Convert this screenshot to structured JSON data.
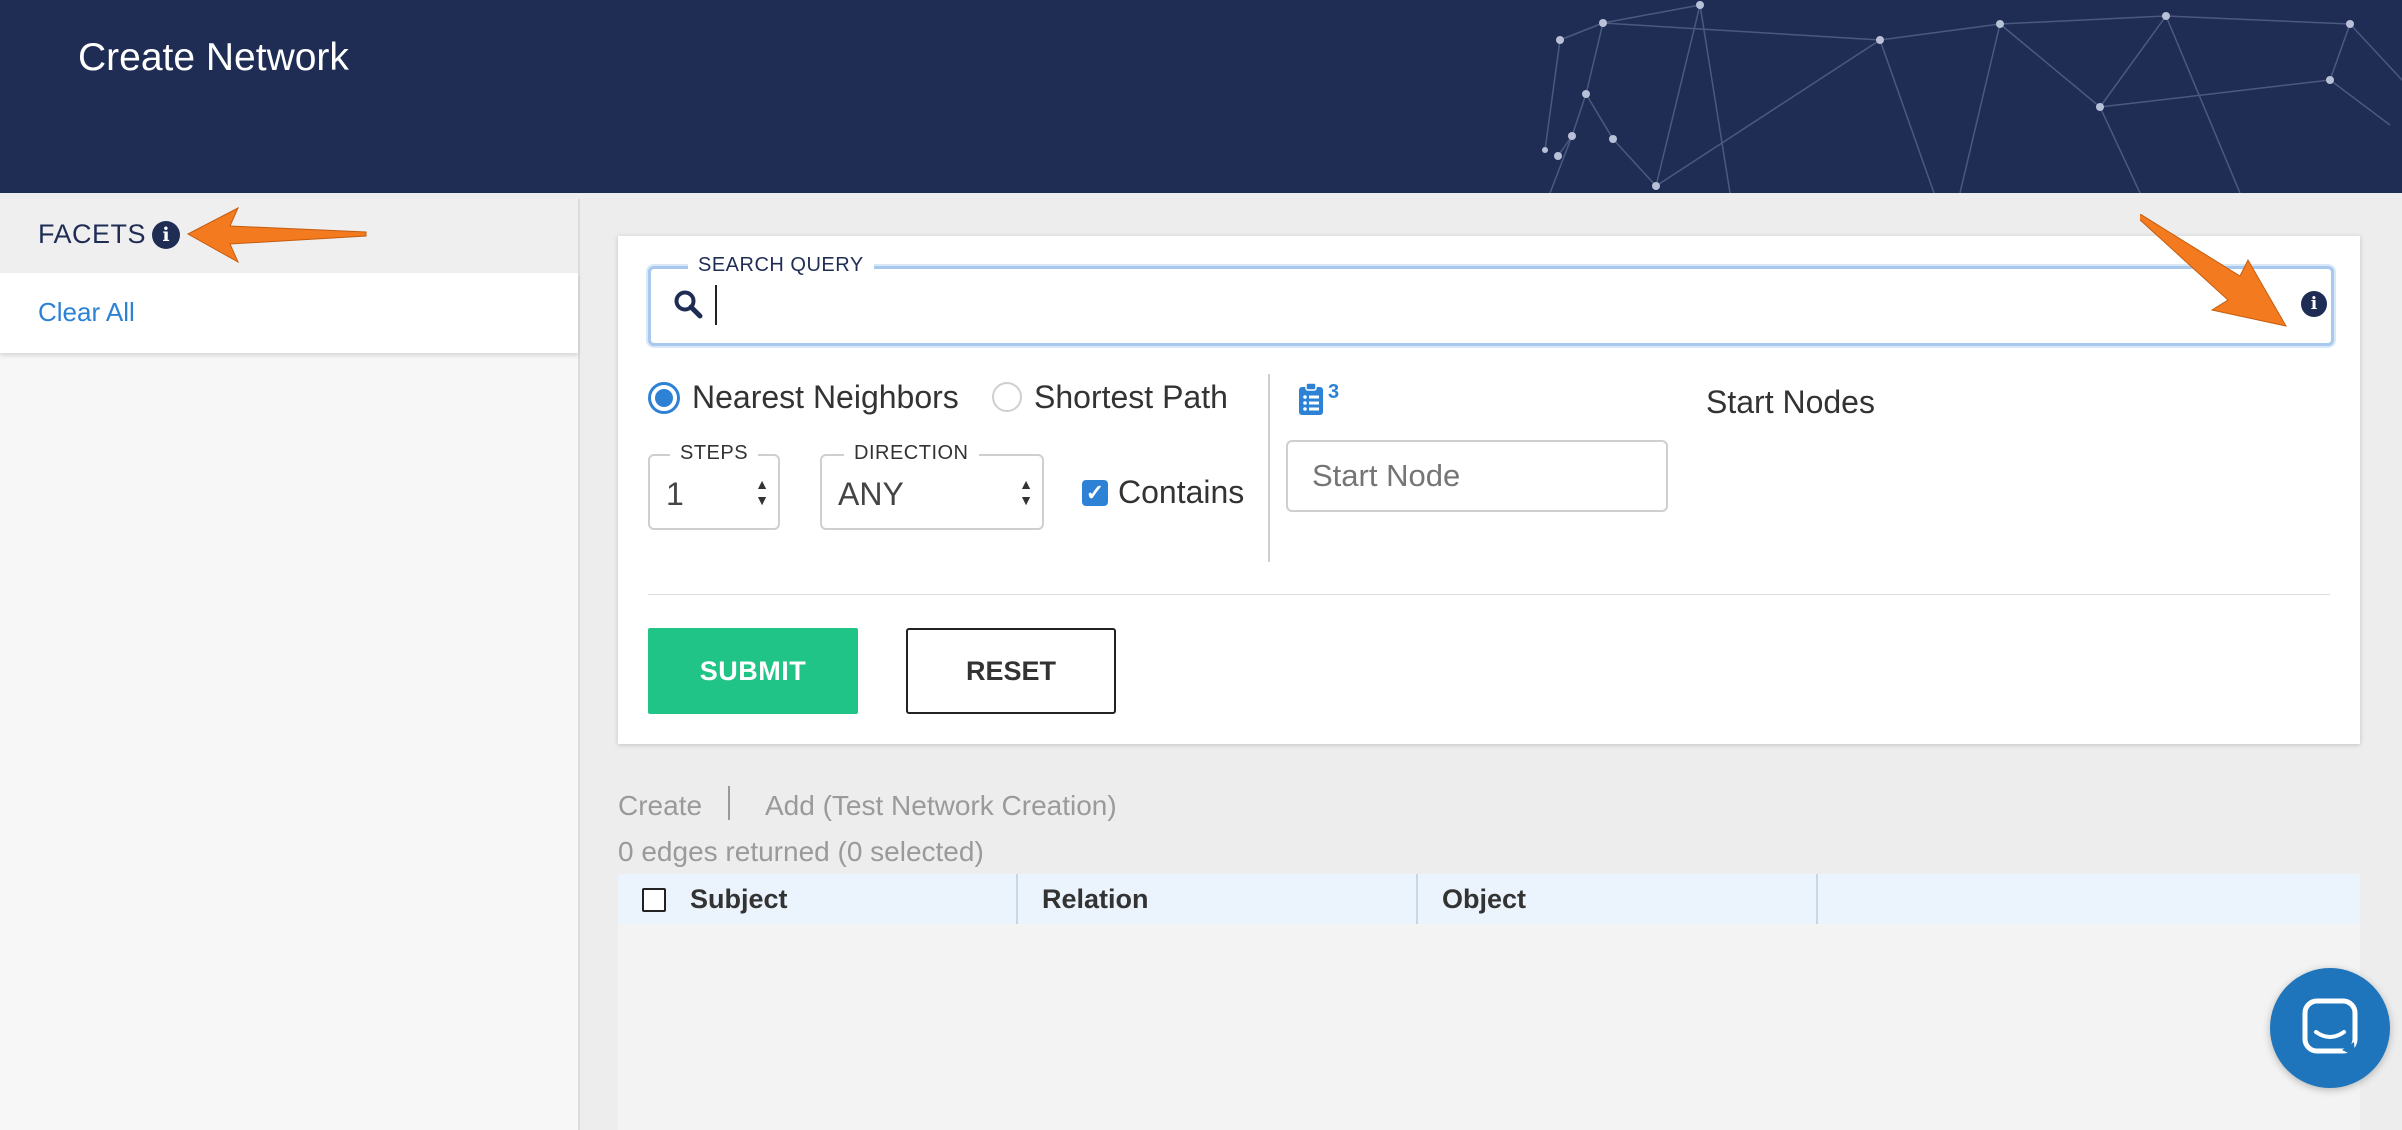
{
  "header": {
    "title": "Create Network"
  },
  "sidebar": {
    "facets_label": "FACETS",
    "clear_all": "Clear All"
  },
  "search": {
    "legend": "SEARCH QUERY",
    "value": ""
  },
  "mode": {
    "options": [
      {
        "label": "Nearest Neighbors",
        "selected": true
      },
      {
        "label": "Shortest Path",
        "selected": false
      }
    ]
  },
  "steps": {
    "legend": "STEPS",
    "value": "1"
  },
  "direction": {
    "legend": "DIRECTION",
    "value": "ANY"
  },
  "contains": {
    "label": "Contains",
    "checked": true
  },
  "start_node": {
    "badge": "3",
    "placeholder": "Start Node",
    "list_label": "Start Nodes"
  },
  "actions": {
    "submit": "SUBMIT",
    "reset": "RESET"
  },
  "results": {
    "tabs": [
      "Create",
      "Add (Test Network Creation)"
    ],
    "count_text": "0 edges returned (0 selected)",
    "columns": [
      "Subject",
      "Relation",
      "Object"
    ]
  },
  "colors": {
    "header_bg": "#1f2d55",
    "accent": "#2d82d6",
    "submit": "#20c486",
    "annotation_arrow": "#f47a1f",
    "chat": "#1e75bb"
  }
}
